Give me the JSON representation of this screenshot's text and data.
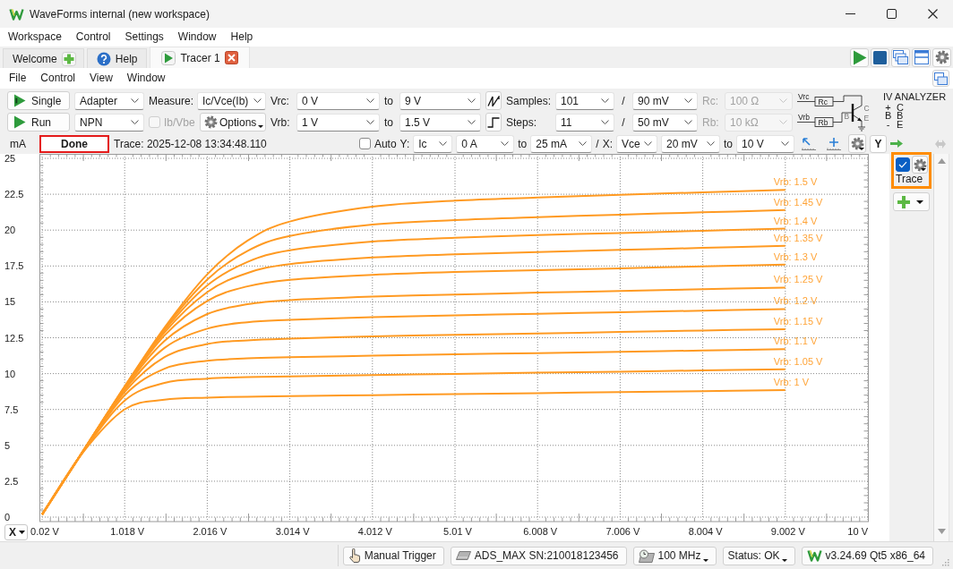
{
  "window": {
    "title": "WaveForms internal (new workspace)"
  },
  "menu": [
    "Workspace",
    "Control",
    "Settings",
    "Window",
    "Help"
  ],
  "tabs": [
    {
      "label": "Welcome",
      "kind": "welcome",
      "selected": false
    },
    {
      "label": "Help",
      "kind": "help",
      "selected": false
    },
    {
      "label": "Tracer 1",
      "kind": "instrument",
      "selected": true
    }
  ],
  "instrument_menu": [
    "File",
    "Control",
    "View",
    "Window"
  ],
  "toolbar": {
    "single": "Single",
    "run": "Run",
    "adapter": "Adapter",
    "device_type": "NPN",
    "measure": {
      "label": "Measure:",
      "value": "Ic/Vce(Ib)"
    },
    "ib_vbe": {
      "label": "Ib/Vbe",
      "checked": false,
      "disabled": true
    },
    "options": "Options",
    "sweeps": [
      {
        "label": "Vrc:",
        "from": "0 V",
        "to_label": "to",
        "to": "9 V",
        "kind": "ramp",
        "count_label": "Samples:",
        "count": "101",
        "step_label": "/",
        "step": "90 mV",
        "resistor_label": "Rc:",
        "resistor": "100 Ω",
        "resistor_disabled": true
      },
      {
        "label": "Vrb:",
        "from": "1 V",
        "to_label": "to",
        "to": "1.5 V",
        "kind": "steps",
        "count_label": "Steps:",
        "count": "11",
        "step_label": "/",
        "step": "50 mV",
        "resistor_label": "Rb:",
        "resistor": "10 kΩ",
        "resistor_disabled": true
      }
    ]
  },
  "circuit": {
    "vrc": "Vrc",
    "rc": "Rc",
    "vrb": "Vrb",
    "rb": "Rb",
    "base": "B",
    "collector": "C",
    "emitter": "E"
  },
  "analyzer": {
    "title": "IV ANALYZER",
    "pins": [
      {
        "pin": "+",
        "terminal": "C"
      },
      {
        "pin": "B",
        "terminal": "B"
      },
      {
        "pin": "-",
        "terminal": "E"
      }
    ]
  },
  "plot": {
    "status": "Done",
    "trace": "Trace: 2025-12-08 13:34:48.110",
    "auto": {
      "label": "Auto",
      "checked": false
    },
    "y_label": "Y:",
    "y_source": "Ic",
    "y_from": "0 A",
    "y_to_label": "to",
    "y_to": "25 mA",
    "separator": "/",
    "x_label": "X:",
    "x_source": "Vce",
    "x_from": "20 mV",
    "x_to_label": "to",
    "x_to": "10 V",
    "y_button": "Y",
    "x_button": "X",
    "chart_data": {
      "type": "line",
      "ylabel": "mA",
      "grid": true,
      "x": [
        0.02,
        0.5,
        1.018,
        1.5,
        2.016,
        2.5,
        3.014,
        4.012,
        5.01,
        6.008,
        7.006,
        8.004,
        9.002
      ],
      "series": [
        {
          "name": "Vrb: 1.5 V",
          "color": "#ff9a22",
          "values": [
            0.18,
            4.47,
            9.11,
            13.22,
            16.92,
            19.25,
            20.6,
            21.63,
            22.05,
            22.27,
            22.46,
            22.63,
            22.8
          ]
        },
        {
          "name": "Vrb: 1.45 V",
          "color": "#ff9a22",
          "values": [
            0.18,
            4.47,
            9.09,
            13.13,
            16.56,
            18.54,
            19.59,
            20.38,
            20.69,
            20.9,
            21.08,
            21.24,
            21.4
          ]
        },
        {
          "name": "Vrb: 1.4 V",
          "color": "#ff9a22",
          "values": [
            0.18,
            4.47,
            9.06,
            13.01,
            16.15,
            17.78,
            18.6,
            19.2,
            19.47,
            19.65,
            19.8,
            19.95,
            20.1
          ]
        },
        {
          "name": "Vrb: 1.35 V",
          "color": "#ff9a22",
          "values": [
            0.18,
            4.46,
            9.04,
            12.87,
            15.68,
            17.01,
            17.63,
            18.09,
            18.31,
            18.47,
            18.62,
            18.76,
            18.9
          ]
        },
        {
          "name": "Vrb: 1.3 V",
          "color": "#ff9a22",
          "values": [
            0.18,
            4.46,
            9.01,
            12.66,
            15.07,
            16.08,
            16.54,
            16.88,
            17.08,
            17.21,
            17.34,
            17.47,
            17.6
          ]
        },
        {
          "name": "Vrb: 1.25 V",
          "color": "#ff9a22",
          "values": [
            0.18,
            4.45,
            8.95,
            12.28,
            14.15,
            14.83,
            15.12,
            15.36,
            15.51,
            15.64,
            15.76,
            15.88,
            16.0
          ]
        },
        {
          "name": "Vrb: 1.2 V",
          "color": "#ff9a22",
          "values": [
            0.18,
            4.45,
            8.86,
            11.79,
            13.13,
            13.58,
            13.74,
            13.93,
            14.06,
            14.17,
            14.28,
            14.39,
            14.5
          ]
        },
        {
          "name": "Vrb: 1.15 V",
          "color": "#ff9a22",
          "values": [
            0.18,
            4.45,
            8.72,
            11.15,
            12.06,
            12.32,
            12.44,
            12.6,
            12.7,
            12.8,
            12.9,
            13.0,
            13.1
          ]
        },
        {
          "name": "Vrb: 1.1 V",
          "color": "#ff9a22",
          "values": [
            0.18,
            4.44,
            8.49,
            10.34,
            10.89,
            11.06,
            11.14,
            11.25,
            11.34,
            11.43,
            11.52,
            11.61,
            11.7
          ]
        },
        {
          "name": "Vrb: 1.05 V",
          "color": "#ff9a22",
          "values": [
            0.18,
            4.42,
            8.12,
            9.35,
            9.65,
            9.75,
            9.8,
            9.9,
            9.98,
            10.06,
            10.14,
            10.22,
            10.3
          ]
        },
        {
          "name": "Vrb: 1 V",
          "color": "#ff9a22",
          "values": [
            0.18,
            4.4,
            7.51,
            8.18,
            8.32,
            8.39,
            8.43,
            8.5,
            8.57,
            8.64,
            8.71,
            8.78,
            8.85
          ]
        }
      ],
      "xlim": [
        0.02,
        10
      ],
      "ylim": [
        0,
        25
      ],
      "xticks": [
        {
          "value": 0.02,
          "label": "0.02 V"
        },
        {
          "value": 1.018,
          "label": "1.018 V"
        },
        {
          "value": 2.016,
          "label": "2.016 V"
        },
        {
          "value": 3.014,
          "label": "3.014 V"
        },
        {
          "value": 4.012,
          "label": "4.012 V"
        },
        {
          "value": 5.01,
          "label": "5.01 V"
        },
        {
          "value": 6.008,
          "label": "6.008 V"
        },
        {
          "value": 7.006,
          "label": "7.006 V"
        },
        {
          "value": 8.004,
          "label": "8.004 V"
        },
        {
          "value": 9.002,
          "label": "9.002 V"
        },
        {
          "value": 10,
          "label": "10 V"
        }
      ],
      "yticks": [
        0,
        2.5,
        5,
        7.5,
        10,
        12.5,
        15,
        17.5,
        20,
        22.5,
        25
      ]
    }
  },
  "traces": [
    {
      "label": "Trace",
      "checked": true,
      "selected": true
    }
  ],
  "status_bar": [
    {
      "kind": "trigger",
      "label": "Manual Trigger",
      "menu": false
    },
    {
      "kind": "device",
      "label": "ADS_MAX SN:210018123456",
      "menu": false
    },
    {
      "kind": "clock",
      "label": "100 MHz",
      "menu": true
    },
    {
      "kind": "status",
      "label": "Status: OK",
      "menu": true
    },
    {
      "kind": "version",
      "label": "v3.24.69 Qt5 x86_64",
      "menu": false
    }
  ]
}
